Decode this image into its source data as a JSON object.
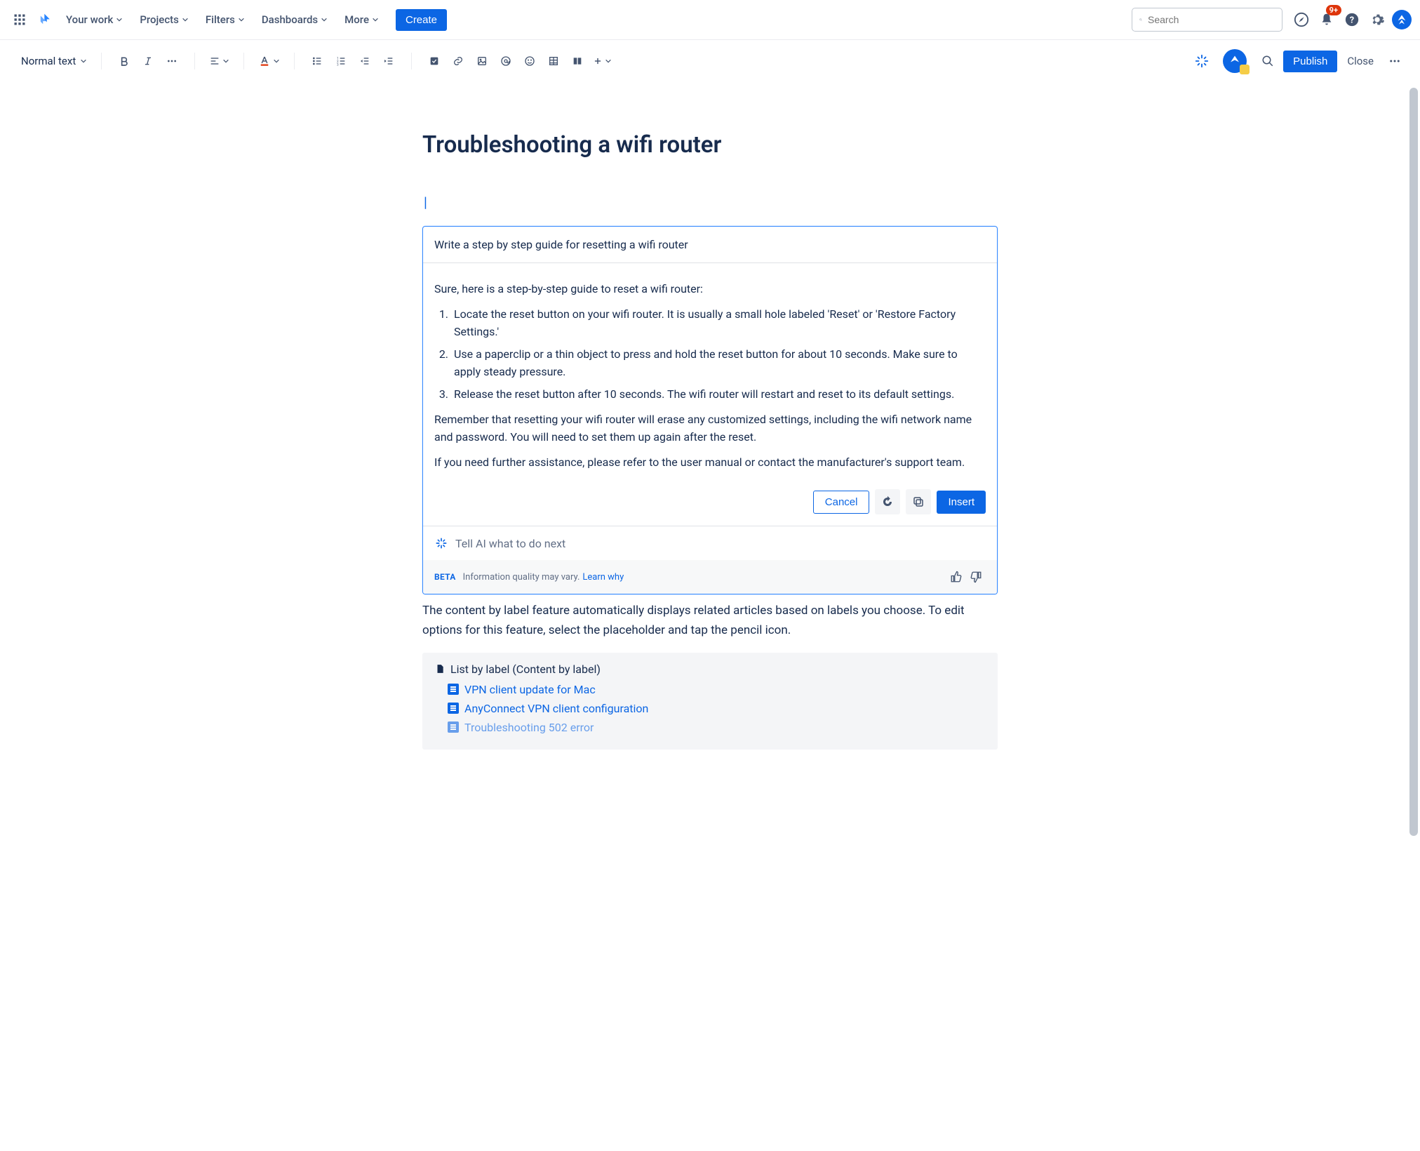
{
  "topnav": {
    "items": [
      "Your work",
      "Projects",
      "Filters",
      "Dashboards",
      "More"
    ],
    "create": "Create",
    "search_placeholder": "Search",
    "notification_badge": "9+"
  },
  "toolbar": {
    "text_style": "Normal text",
    "publish": "Publish",
    "close": "Close"
  },
  "page": {
    "title": "Troubleshooting a wifi router"
  },
  "ai": {
    "prompt": "Write a step by step guide for resetting a wifi router",
    "intro": "Sure, here is a step-by-step guide to reset a wifi router:",
    "steps": [
      "Locate the reset button on your wifi router. It is usually a small hole labeled 'Reset' or 'Restore Factory Settings.'",
      "Use a paperclip or a thin object to press and hold the reset button for about 10 seconds. Make sure to apply steady pressure.",
      "Release the reset button after 10 seconds. The wifi router will restart and reset to its default settings."
    ],
    "note1": "Remember that resetting your wifi router will erase any customized settings, including the wifi network name and password. You will need to set them up again after the reset.",
    "note2": "If you need further assistance, please refer to the user manual or contact the manufacturer's support team.",
    "cancel": "Cancel",
    "insert": "Insert",
    "followup_placeholder": "Tell AI what to do next",
    "beta": "BETA",
    "disclaimer": "Information quality may vary.",
    "learn_why": "Learn why"
  },
  "body": {
    "paragraph": "The content by label feature automatically displays related articles based on labels you choose. To edit options for this feature, select the placeholder and tap the pencil icon."
  },
  "macro": {
    "title": "List by label (Content by label)",
    "links": [
      "VPN client update for Mac",
      "AnyConnect VPN client configuration",
      "Troubleshooting 502 error"
    ]
  }
}
